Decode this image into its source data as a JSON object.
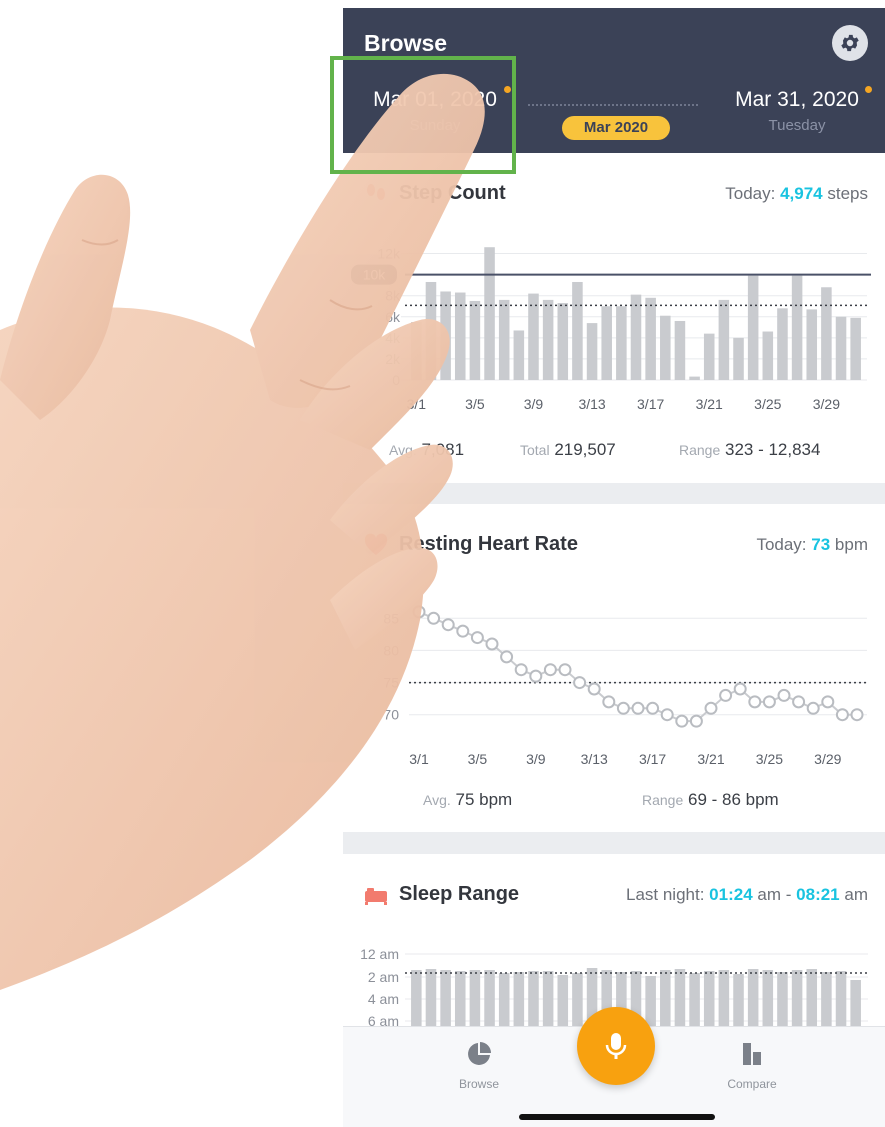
{
  "header": {
    "title": "Browse",
    "start_date": "Mar 01, 2020",
    "start_weekday": "Sunday",
    "end_date": "Mar 31, 2020",
    "end_weekday": "Tuesday",
    "month_pill": "Mar 2020",
    "settings_icon": "gear-icon",
    "accent_color": "#f8c33c"
  },
  "step_card": {
    "title": "Step Count",
    "today_label": "Today:",
    "today_value": "4,974",
    "today_unit": "steps",
    "goal_label": "10k",
    "avg_label": "Avg.",
    "avg_value": "7,081",
    "total_label": "Total",
    "total_value": "219,507",
    "range_label": "Range",
    "range_value": "323 - 12,834",
    "icon": "footprints-icon"
  },
  "heart_card": {
    "title": "Resting Heart Rate",
    "today_label": "Today:",
    "today_value": "73",
    "today_unit": "bpm",
    "avg_label": "Avg.",
    "avg_value": "75 bpm",
    "range_label": "Range",
    "range_value": "69  - 86 bpm",
    "icon": "heart-icon"
  },
  "sleep_card": {
    "title": "Sleep Range",
    "last_label": "Last night:",
    "start_time": "01:24",
    "start_suffix": "am",
    "separator": "-",
    "end_time": "08:21",
    "end_suffix": "am",
    "icon": "bed-icon"
  },
  "nav": {
    "browse_label": "Browse",
    "compare_label": "Compare",
    "mic_icon": "microphone-icon"
  },
  "chart_data": [
    {
      "type": "bar",
      "x_tick_labels": [
        "3/1",
        "3/5",
        "3/9",
        "3/13",
        "3/17",
        "3/21",
        "3/25",
        "3/29"
      ],
      "y_tick_labels": [
        "12k",
        "8k",
        "6k",
        "4k",
        "2k",
        "0"
      ],
      "ylim": [
        0,
        13000
      ],
      "goal": 10000,
      "average": 7081,
      "values": [
        5500,
        9300,
        8400,
        8300,
        7500,
        12600,
        7600,
        4700,
        8200,
        7600,
        7300,
        9300,
        5400,
        7000,
        7000,
        8100,
        7800,
        6100,
        5600,
        323,
        4400,
        7600,
        4000,
        9900,
        4600,
        6800,
        9900,
        6700,
        8800,
        6000,
        5900
      ]
    },
    {
      "type": "line",
      "x_tick_labels": [
        "3/1",
        "3/5",
        "3/9",
        "3/13",
        "3/17",
        "3/21",
        "3/25",
        "3/29"
      ],
      "y_tick_labels": [
        "85",
        "80",
        "75",
        "70"
      ],
      "ylim": [
        67,
        88
      ],
      "average": 75,
      "values": [
        86,
        85,
        84,
        83,
        82,
        81,
        79,
        77,
        76,
        77,
        77,
        75,
        74,
        72,
        71,
        71,
        71,
        70,
        69,
        69,
        71,
        73,
        74,
        72,
        72,
        73,
        72,
        71,
        72,
        70,
        70
      ]
    },
    {
      "type": "bar",
      "y_tick_labels": [
        "12 am",
        "2 am",
        "4 am",
        "6 am"
      ]
    }
  ]
}
